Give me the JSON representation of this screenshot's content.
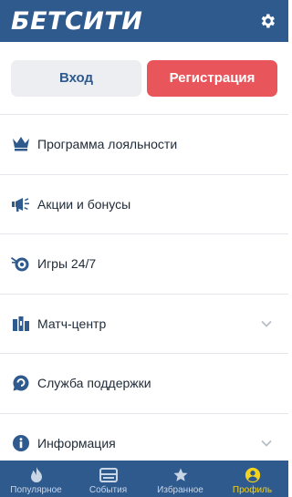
{
  "header": {
    "logo_text": "БЕТСИТИ",
    "settings_icon": "gear-icon"
  },
  "auth": {
    "login_label": "Вход",
    "register_label": "Регистрация"
  },
  "menu": {
    "items": [
      {
        "label": "Программа лояльности",
        "icon": "crown-icon",
        "has_chevron": false
      },
      {
        "label": "Акции и бонусы",
        "icon": "megaphone-icon",
        "has_chevron": false
      },
      {
        "label": "Игры 24/7",
        "icon": "game-target-icon",
        "has_chevron": false
      },
      {
        "label": "Матч-центр",
        "icon": "stats-icon",
        "has_chevron": true
      },
      {
        "label": "Служба поддержки",
        "icon": "chat-bubble-icon",
        "has_chevron": false
      },
      {
        "label": "Информация",
        "icon": "info-icon",
        "has_chevron": true
      }
    ]
  },
  "tabbar": {
    "active": "Профиль",
    "tabs": [
      {
        "label": "Популярное",
        "icon": "flame-icon"
      },
      {
        "label": "События",
        "icon": "events-icon"
      },
      {
        "label": "Избранное",
        "icon": "star-icon"
      },
      {
        "label": "Профиль",
        "icon": "user-icon"
      }
    ]
  },
  "colors": {
    "brand_blue": "#2f5a8e",
    "register_red": "#e8565c",
    "active_tab_yellow": "#f5d21e"
  }
}
